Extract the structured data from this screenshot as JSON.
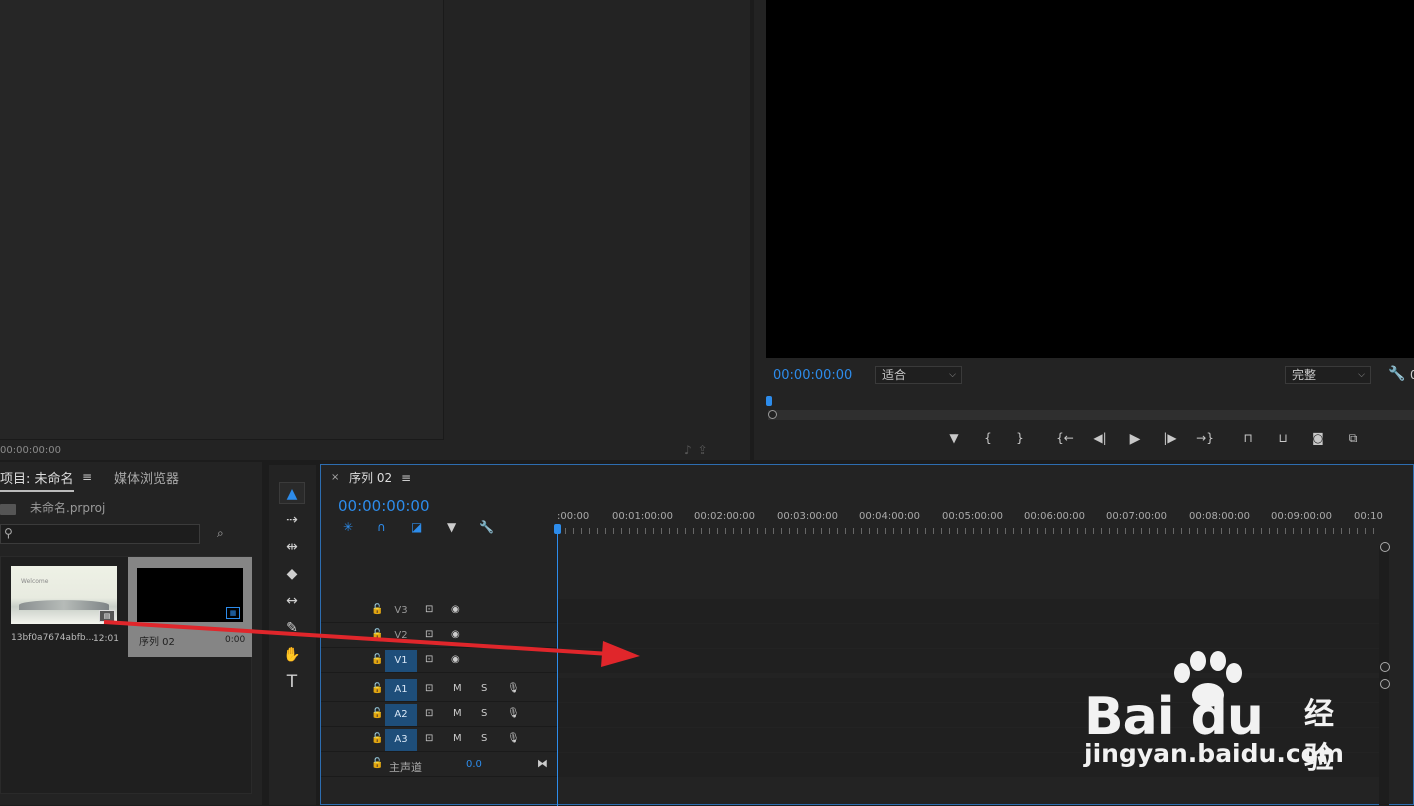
{
  "source_monitor": {
    "timecode": "00:00:00:00",
    "icons": [
      "audio-note-icon",
      "export-icon"
    ]
  },
  "program_monitor": {
    "timecode": "00:00:00:00",
    "zoom": "适合",
    "quality": "完整",
    "right_value": "0",
    "transport": [
      "marker-icon",
      "in-point-icon",
      "out-point-icon",
      "go-to-in-icon",
      "step-back-icon",
      "play-icon",
      "step-forward-icon",
      "go-to-out-icon",
      "lift-icon",
      "extract-icon",
      "camera-icon",
      "compare-icon"
    ]
  },
  "project": {
    "tab_label": "项目: 未命名",
    "media_browser_label": "媒体浏览器",
    "file_name": "未命名.prproj",
    "search_placeholder": "",
    "items": [
      {
        "name": "13bf0a7674abfb...",
        "duration": "12:01",
        "thumb_title": "Welcome"
      },
      {
        "name": "序列 02",
        "duration": "0:00"
      }
    ]
  },
  "timeline": {
    "tab_label": "序列 02",
    "timecode": "00:00:00:00",
    "ruler": [
      ":00:00",
      "00:01:00:00",
      "00:02:00:00",
      "00:03:00:00",
      "00:04:00:00",
      "00:05:00:00",
      "00:06:00:00",
      "00:07:00:00",
      "00:08:00:00",
      "00:09:00:00",
      "00:10"
    ],
    "video_tracks": [
      {
        "label": "V3",
        "targeted": false
      },
      {
        "label": "V2",
        "targeted": false
      },
      {
        "label": "V1",
        "targeted": true
      }
    ],
    "audio_tracks": [
      {
        "label": "A1",
        "m": "M",
        "s": "S"
      },
      {
        "label": "A2",
        "m": "M",
        "s": "S"
      },
      {
        "label": "A3",
        "m": "M",
        "s": "S"
      }
    ],
    "master": {
      "label": "主声道",
      "value": "0.0"
    }
  },
  "watermark": {
    "brand": "Bai du",
    "product": "经验",
    "url": "jingyan.baidu.com"
  },
  "colors": {
    "accent": "#2d8ceb",
    "arrow": "#e0262b"
  }
}
